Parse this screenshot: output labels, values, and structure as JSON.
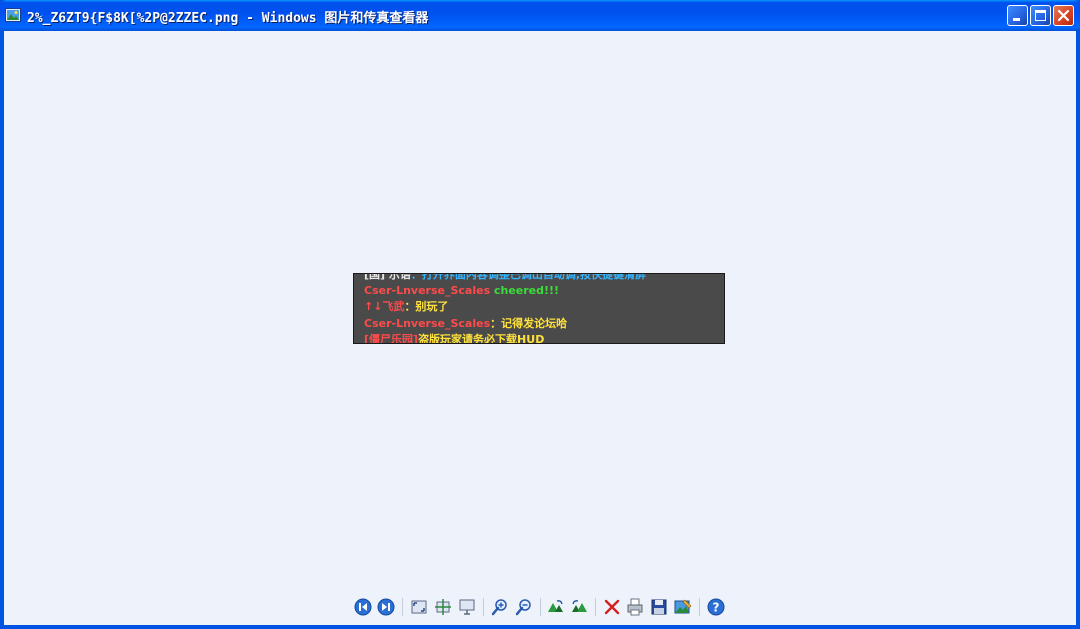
{
  "window": {
    "title": "2%_Z6ZT9{F$8K[%2P@2ZZEC.png - Windows 图片和传真查看器"
  },
  "preview": {
    "lines": [
      {
        "name": "[国] 示语",
        "text": "：打开界面内容调整已调出自动调,按快捷键清屏",
        "name_color": "#e8e8e8",
        "text_color": "#33b5ff"
      },
      {
        "name": "Cser-Lnverse_Scales",
        "text": "cheered!!!",
        "name_color": "#ff4a4a",
        "text_color": "#3cdc3c"
      },
      {
        "name": "↑↓飞武",
        "text": "：别玩了",
        "name_color": "#ff4a4a",
        "text_color": "#ffe23c"
      },
      {
        "name": "Cser-Lnverse_Scales",
        "text": "：记得发论坛哈",
        "name_color": "#ff4a4a",
        "text_color": "#ffe23c"
      },
      {
        "name": "[僵尸乐园]",
        "text": "盗版玩家请务必下载HUD",
        "name_color": "#ff4a4a",
        "text_color": "#ffe23c"
      }
    ]
  },
  "toolbar": {
    "tools": [
      {
        "icon": "previous-image-icon"
      },
      {
        "icon": "next-image-icon"
      },
      {
        "icon": "best-fit-icon"
      },
      {
        "icon": "actual-size-icon"
      },
      {
        "icon": "slideshow-icon"
      },
      {
        "icon": "zoom-in-icon"
      },
      {
        "icon": "zoom-out-icon"
      },
      {
        "icon": "rotate-clockwise-icon"
      },
      {
        "icon": "rotate-counterclockwise-icon"
      },
      {
        "icon": "delete-icon"
      },
      {
        "icon": "print-icon"
      },
      {
        "icon": "save-copy-icon"
      },
      {
        "icon": "open-for-editing-icon"
      },
      {
        "icon": "help-icon"
      }
    ]
  }
}
